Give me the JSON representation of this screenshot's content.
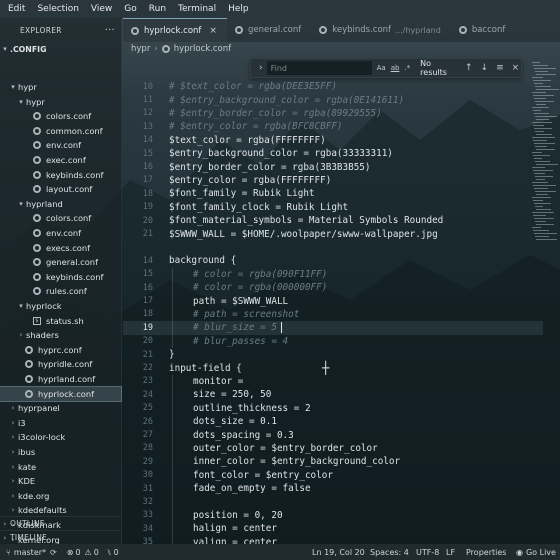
{
  "menubar": [
    "Edit",
    "Selection",
    "View",
    "Go",
    "Run",
    "Terminal",
    "Help"
  ],
  "sidebar": {
    "title": "EXPLORER",
    "root": ".CONFIG",
    "outline": "OUTLINE",
    "timeline": "TIMELINE"
  },
  "tree": [
    {
      "label": "hypr",
      "level": 1,
      "type": "folder",
      "open": true
    },
    {
      "label": "hypr",
      "level": 2,
      "type": "folder",
      "open": true
    },
    {
      "label": "colors.conf",
      "level": 3,
      "type": "gear"
    },
    {
      "label": "common.conf",
      "level": 3,
      "type": "gear"
    },
    {
      "label": "env.conf",
      "level": 3,
      "type": "gear"
    },
    {
      "label": "exec.conf",
      "level": 3,
      "type": "gear"
    },
    {
      "label": "keybinds.conf",
      "level": 3,
      "type": "gear"
    },
    {
      "label": "layout.conf",
      "level": 3,
      "type": "gear"
    },
    {
      "label": "hyprland",
      "level": 2,
      "type": "folder",
      "open": true
    },
    {
      "label": "colors.conf",
      "level": 3,
      "type": "gear"
    },
    {
      "label": "env.conf",
      "level": 3,
      "type": "gear"
    },
    {
      "label": "execs.conf",
      "level": 3,
      "type": "gear"
    },
    {
      "label": "general.conf",
      "level": 3,
      "type": "gear"
    },
    {
      "label": "keybinds.conf",
      "level": 3,
      "type": "gear"
    },
    {
      "label": "rules.conf",
      "level": 3,
      "type": "gear"
    },
    {
      "label": "hyprlock",
      "level": 2,
      "type": "folder",
      "open": true
    },
    {
      "label": "status.sh",
      "level": 3,
      "type": "sh"
    },
    {
      "label": "shaders",
      "level": 2,
      "type": "folder",
      "open": false
    },
    {
      "label": "hyprc.conf",
      "level": 2,
      "type": "gear"
    },
    {
      "label": "hypridle.conf",
      "level": 2,
      "type": "gear"
    },
    {
      "label": "hyprland.conf",
      "level": 2,
      "type": "gear"
    },
    {
      "label": "hyprlock.conf",
      "level": 2,
      "type": "gear",
      "selected": true
    },
    {
      "label": "hyprpanel",
      "level": 1,
      "type": "folder",
      "open": false
    },
    {
      "label": "i3",
      "level": 1,
      "type": "folder",
      "open": false
    },
    {
      "label": "i3color-lock",
      "level": 1,
      "type": "folder",
      "open": false
    },
    {
      "label": "ibus",
      "level": 1,
      "type": "folder",
      "open": false
    },
    {
      "label": "kate",
      "level": 1,
      "type": "folder",
      "open": false
    },
    {
      "label": "KDE",
      "level": 1,
      "type": "folder",
      "open": false
    },
    {
      "label": "kde.org",
      "level": 1,
      "type": "folder",
      "open": false
    },
    {
      "label": "kdedefaults",
      "level": 1,
      "type": "folder",
      "open": false
    },
    {
      "label": "kdiskmark",
      "level": 1,
      "type": "folder",
      "open": false
    },
    {
      "label": "kernel.org",
      "level": 1,
      "type": "folder",
      "open": false
    }
  ],
  "tabs": [
    {
      "label": "hyprlock.conf",
      "active": true,
      "close": "×",
      "extra": ""
    },
    {
      "label": "general.conf",
      "active": false,
      "close": "",
      "extra": ""
    },
    {
      "label": "keybinds.conf",
      "active": false,
      "close": "",
      "extra": ".../hyprland"
    },
    {
      "label": "bacconf",
      "active": false,
      "close": "",
      "extra": ""
    }
  ],
  "breadcrumb": [
    "hypr",
    "hyprlock.conf"
  ],
  "find": {
    "placeholder": "Find",
    "case": "Aa",
    "word": "ab",
    "regex": ".*",
    "result": "No results",
    "up": "↑",
    "down": "↓",
    "menu": "≡",
    "close": "×"
  },
  "editor": {
    "current_line": 19,
    "lines": [
      {
        "n": "10",
        "t": "# $text_color = rgba(DEE3E5FF)",
        "k": "com",
        "i": 0
      },
      {
        "n": "11",
        "t": "# $entry_background_color = rgba(0E141611)",
        "k": "com",
        "i": 0
      },
      {
        "n": "12",
        "t": "# $entry_border_color = rgba(89929555)",
        "k": "com",
        "i": 0
      },
      {
        "n": "13",
        "t": "# $entry_color = rgba(BFC8CBFF)",
        "k": "com",
        "i": 0
      },
      {
        "n": "14",
        "t": "$text_color = rgba(FFFFFFFF)",
        "k": "norm",
        "i": 0
      },
      {
        "n": "15",
        "t": "$entry_background_color = rgba(33333311)",
        "k": "norm",
        "i": 0
      },
      {
        "n": "16",
        "t": "$entry_border_color = rgba(3B3B3B55)",
        "k": "norm",
        "i": 0
      },
      {
        "n": "17",
        "t": "$entry_color = rgba(FFFFFFFF)",
        "k": "norm",
        "i": 0
      },
      {
        "n": "18",
        "t": "$font_family = Rubik Light",
        "k": "norm",
        "i": 0
      },
      {
        "n": "19",
        "t": "$font_family_clock = Rubik Light",
        "k": "norm",
        "i": 0
      },
      {
        "n": "20",
        "t": "$font_material_symbols = Material Symbols Rounded",
        "k": "norm",
        "i": 0
      },
      {
        "n": "21",
        "t": "$SWWW_WALL = $HOME/.woolpaper/swww-wallpaper.jpg",
        "k": "norm",
        "i": 0
      },
      {
        "n": "",
        "t": "",
        "k": "norm",
        "i": 0
      },
      {
        "n": "14",
        "t": "background {",
        "k": "norm",
        "i": 0
      },
      {
        "n": "15",
        "t": "# color = rgba(090F11FF)",
        "k": "com",
        "i": 1
      },
      {
        "n": "16",
        "t": "# color = rgba(000000FF)",
        "k": "com",
        "i": 1
      },
      {
        "n": "17",
        "t": "path = $SWWW_WALL",
        "k": "norm",
        "i": 1
      },
      {
        "n": "18",
        "t": "# path = screenshot",
        "k": "com",
        "i": 1
      },
      {
        "n": "19",
        "t": "# blur_size = 5",
        "k": "com",
        "i": 1
      },
      {
        "n": "20",
        "t": "# blur_passes = 4",
        "k": "com",
        "i": 1
      },
      {
        "n": "21",
        "t": "}",
        "k": "norm",
        "i": 0
      },
      {
        "n": "22",
        "t": "input-field {",
        "k": "norm",
        "i": 0
      },
      {
        "n": "23",
        "t": "monitor =",
        "k": "norm",
        "i": 1
      },
      {
        "n": "24",
        "t": "size = 250, 50",
        "k": "norm",
        "i": 1
      },
      {
        "n": "25",
        "t": "outline_thickness = 2",
        "k": "norm",
        "i": 1
      },
      {
        "n": "26",
        "t": "dots_size = 0.1",
        "k": "norm",
        "i": 1
      },
      {
        "n": "27",
        "t": "dots_spacing = 0.3",
        "k": "norm",
        "i": 1
      },
      {
        "n": "28",
        "t": "outer_color = $entry_border_color",
        "k": "norm",
        "i": 1
      },
      {
        "n": "29",
        "t": "inner_color = $entry_background_color",
        "k": "norm",
        "i": 1
      },
      {
        "n": "30",
        "t": "font_color = $entry_color",
        "k": "norm",
        "i": 1
      },
      {
        "n": "31",
        "t": "fade_on_empty = false",
        "k": "norm",
        "i": 1
      },
      {
        "n": "32",
        "t": "",
        "k": "norm",
        "i": 0
      },
      {
        "n": "33",
        "t": "position = 0, 20",
        "k": "norm",
        "i": 1
      },
      {
        "n": "34",
        "t": "halign = center",
        "k": "norm",
        "i": 1
      },
      {
        "n": "35",
        "t": "valign = center",
        "k": "norm",
        "i": 1
      }
    ]
  },
  "statusbar": {
    "branch": "master*",
    "sync": "⟳",
    "errors": "0",
    "warnings": "0",
    "ports": "0",
    "position": "Ln 19, Col 20",
    "spaces": "Spaces: 4",
    "encoding": "UTF-8",
    "eol": "LF",
    "language": "Properties",
    "golive": "Go Live",
    "bell": "🔔"
  },
  "colors": {
    "comment": "#6b7c84",
    "code": "#dfe4e8",
    "accent": "#7fa6b8"
  }
}
